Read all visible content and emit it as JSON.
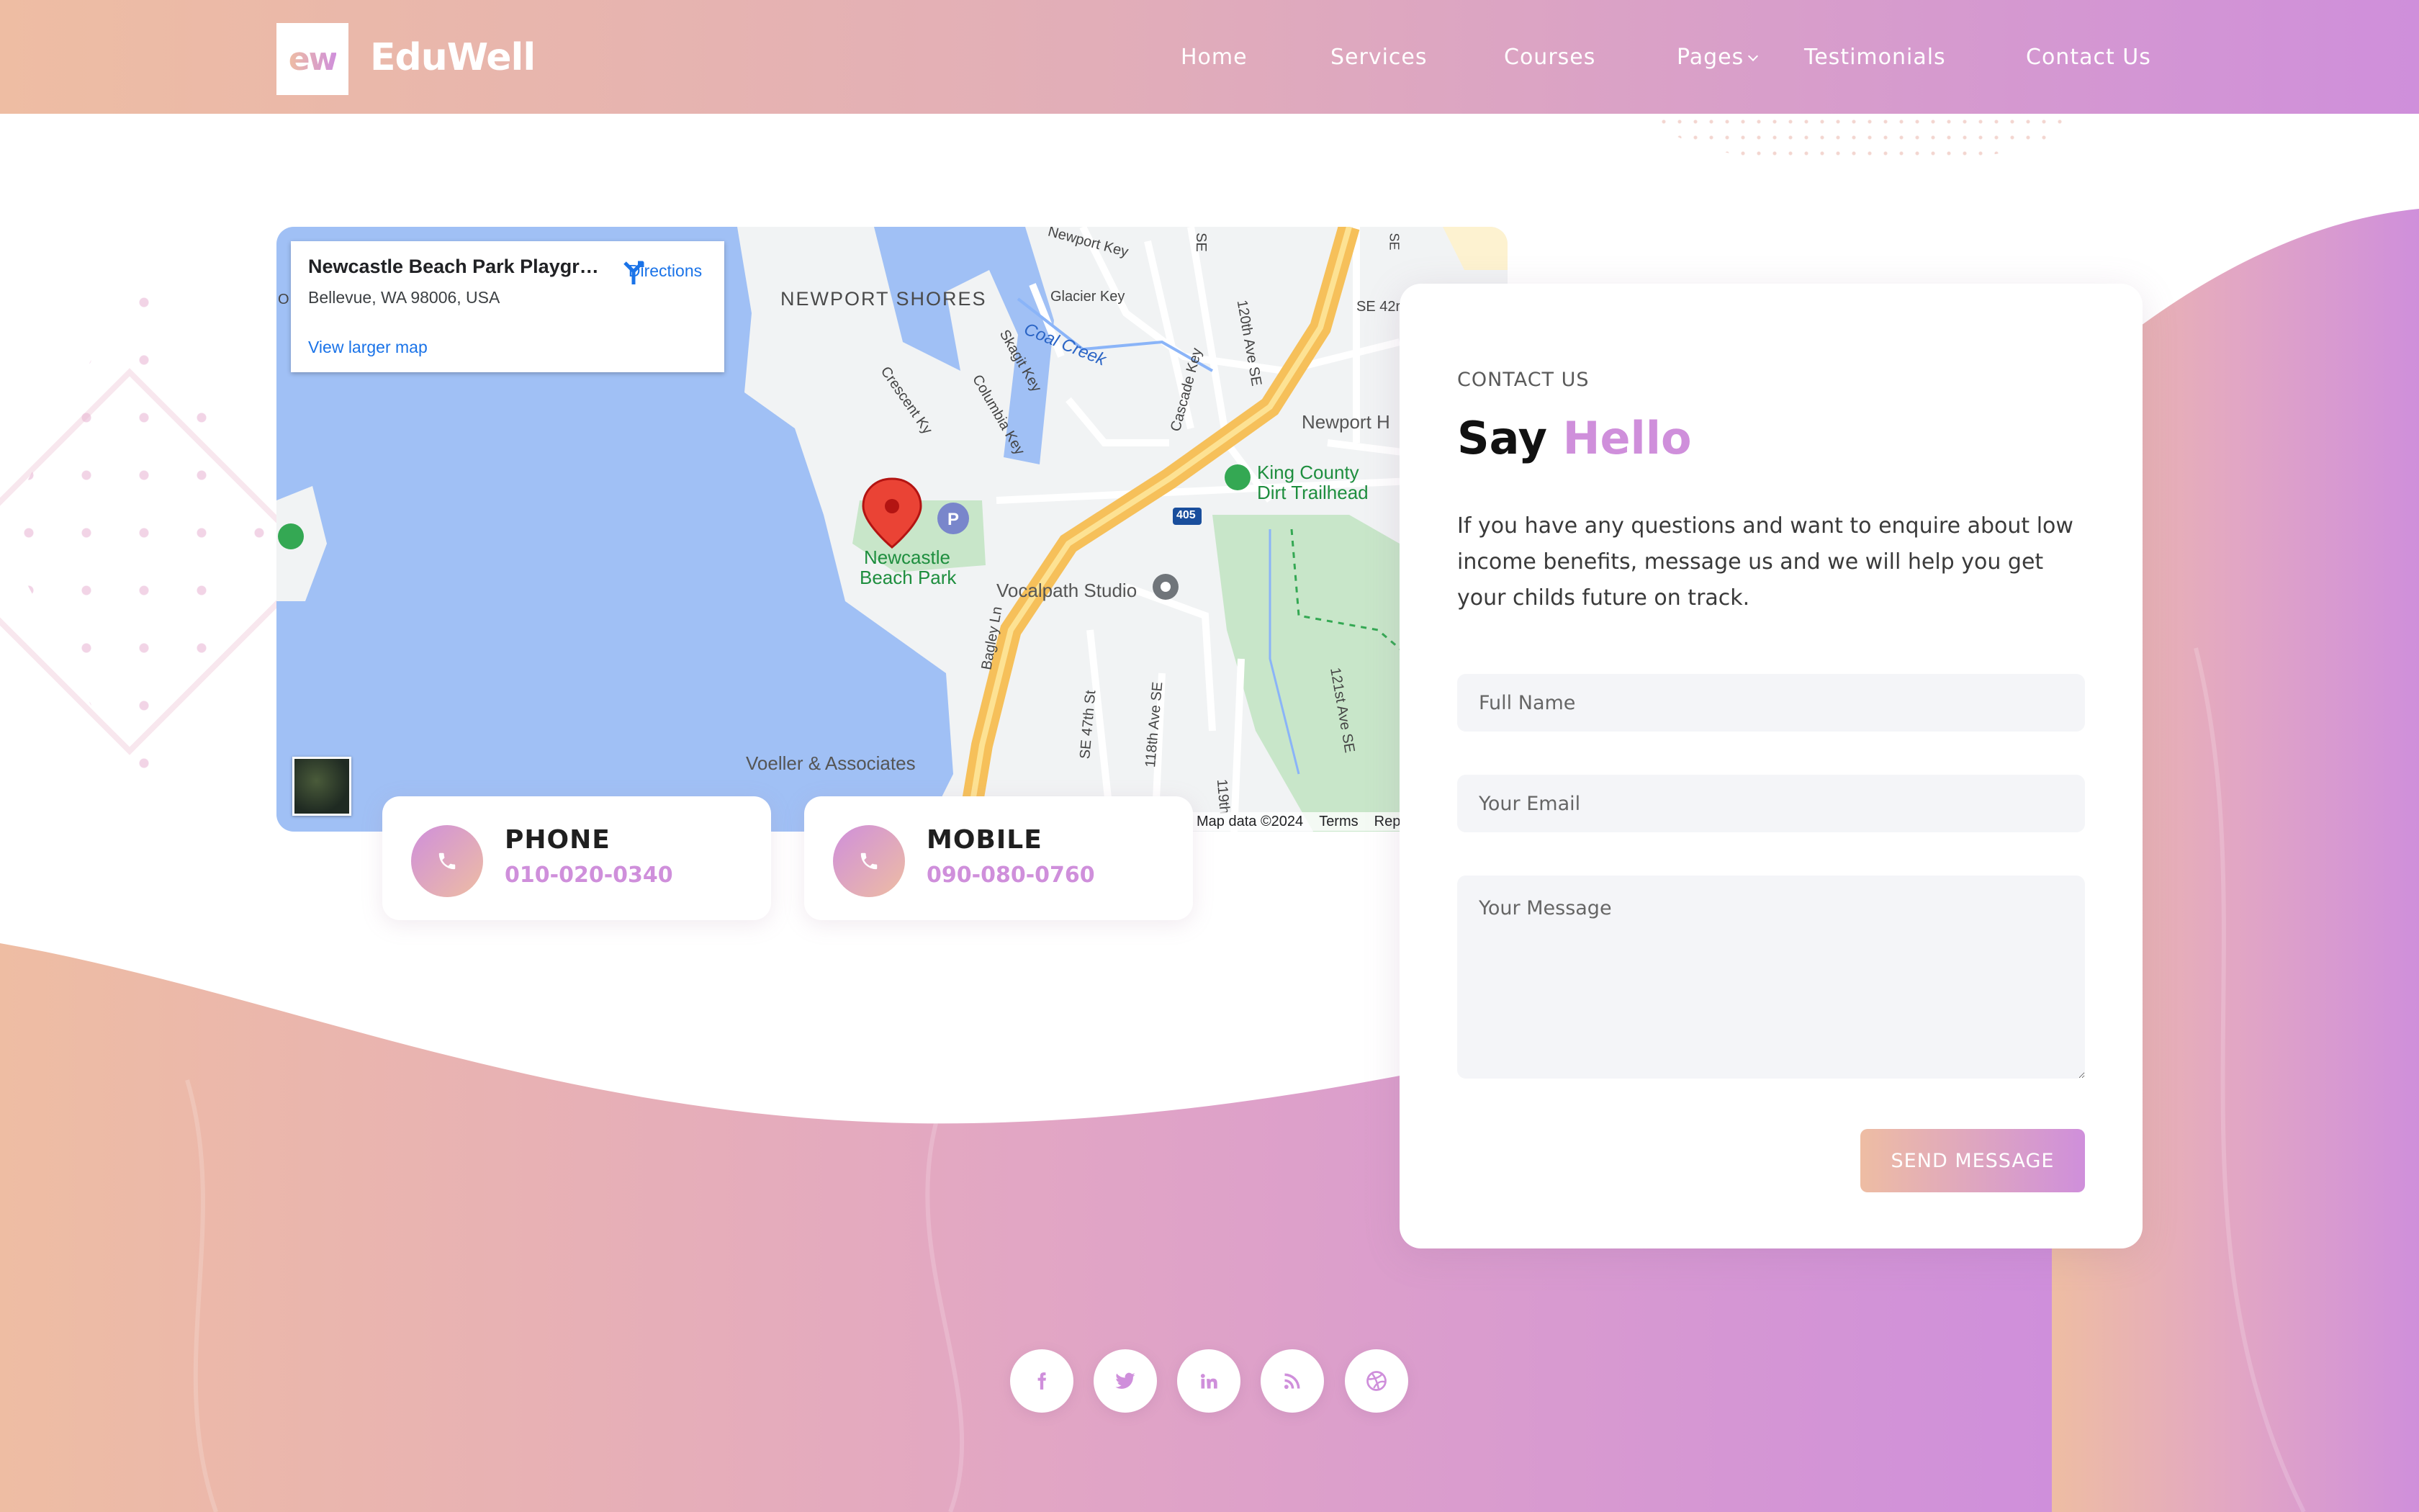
{
  "brand": {
    "logo_mark": "ew",
    "name": "EduWell"
  },
  "nav": {
    "items": [
      {
        "label": "Home"
      },
      {
        "label": "Services"
      },
      {
        "label": "Courses"
      },
      {
        "label": "Pages"
      },
      {
        "label": "Testimonials"
      },
      {
        "label": "Contact Us"
      }
    ]
  },
  "map": {
    "place_name": "Newcastle Beach Park Playgr…",
    "address": "Bellevue, WA 98006, USA",
    "directions_label": "Directions",
    "larger_map_label": "View larger map",
    "labels": {
      "newport_shores": "NEWPORT SHORES",
      "newport_key": "Newport Key",
      "glacier_key": "Glacier Key",
      "coal_creek": "Coal Creek",
      "skagit_key": "Skagit Key",
      "crescent_ky": "Crescent Ky",
      "columbia_key": "Columbia Key",
      "cascade_key": "Cascade Key",
      "ave_120": "120th Ave SE",
      "se_42": "SE 42r",
      "newport_h": "Newport H",
      "king_county": "King County",
      "dirt_trailhead": "Dirt Trailhead",
      "highway": "405",
      "newcastle": "Newcastle",
      "beach_park": "Beach Park",
      "vocalpath": "Vocalpath Studio",
      "bagley": "Bagley Ln",
      "st_47": "SE 47th St",
      "ave_118": "118th Ave SE",
      "ave_121": "121st Ave SE",
      "ave_119": "119th",
      "voeller": "Voeller & Associates",
      "se_edge": "SE",
      "se_top": "SE",
      "o_edge": "O"
    },
    "attribution": {
      "data": "Map data ©2024",
      "terms": "Terms",
      "report": "Rep"
    }
  },
  "info_cards": [
    {
      "title": "PHONE",
      "value": "010-020-0340",
      "icon": "phone-icon"
    },
    {
      "title": "MOBILE",
      "value": "090-080-0760",
      "icon": "phone-icon"
    }
  ],
  "contact": {
    "eyebrow": "CONTACT US",
    "heading_plain": "Say",
    "heading_accent": "Hello",
    "blurb": "If you have any questions and want to enquire about low income benefits, message us and we will help you get your childs future on track.",
    "fields": {
      "name_placeholder": "Full Name",
      "email_placeholder": "Your Email",
      "message_placeholder": "Your Message"
    },
    "submit_label": "SEND MESSAGE"
  },
  "social": [
    {
      "icon": "facebook-icon",
      "glyph": "f"
    },
    {
      "icon": "twitter-icon",
      "glyph": ""
    },
    {
      "icon": "linkedin-icon",
      "glyph": "in"
    },
    {
      "icon": "rss-icon",
      "glyph": ""
    },
    {
      "icon": "dribbble-icon",
      "glyph": ""
    }
  ],
  "colors": {
    "gradient_start": "#eebda3",
    "gradient_end": "#cf8fdb",
    "accent": "#cf8fdb",
    "map_water": "#a0c0f5",
    "map_park": "#c8e6c9",
    "map_highway": "#f6c05a"
  }
}
